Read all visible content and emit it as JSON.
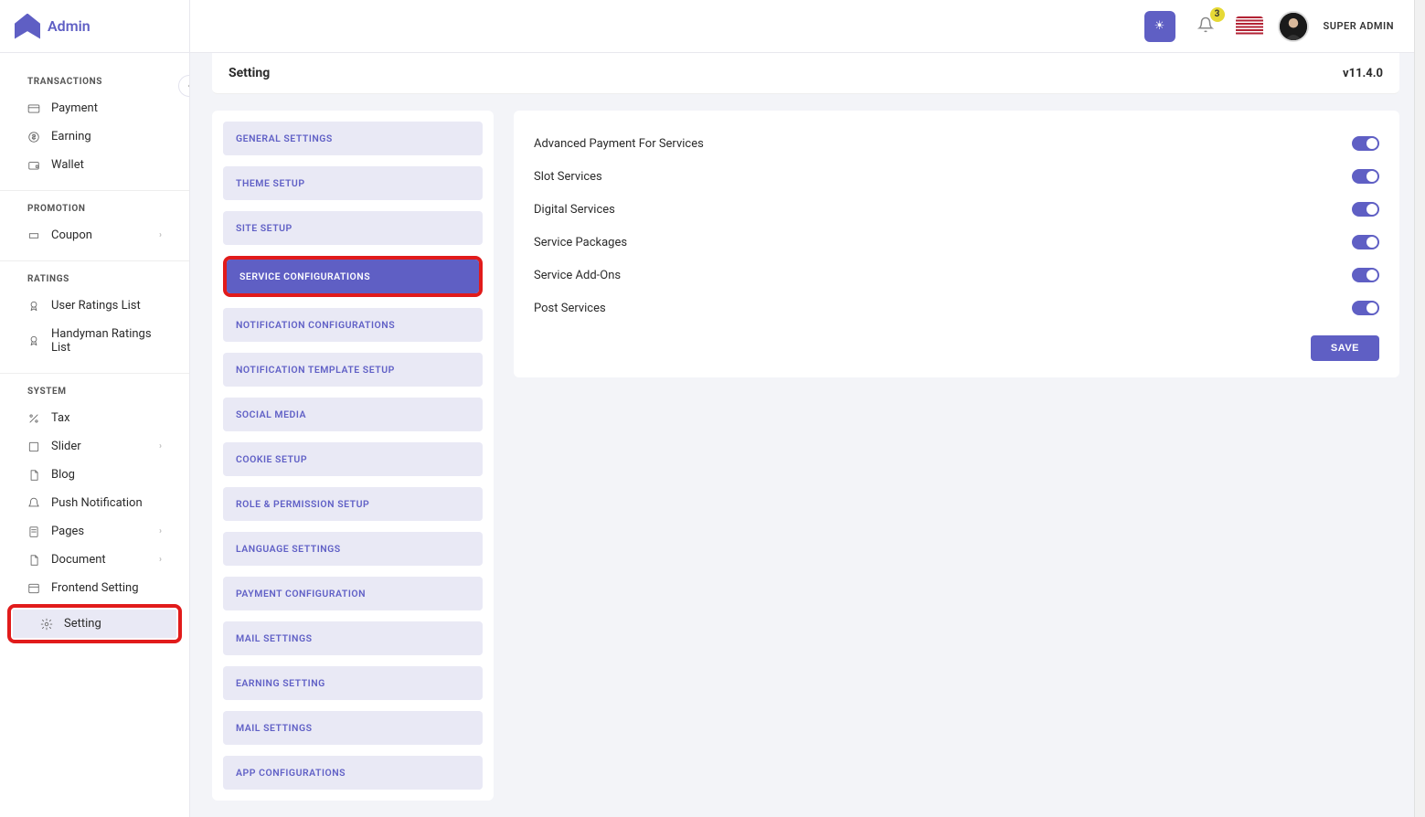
{
  "brand": "Admin",
  "topbar": {
    "badge": "3",
    "username": "SUPER ADMIN"
  },
  "page": {
    "title": "Setting",
    "version": "v11.4.0"
  },
  "sidebar": {
    "sections": [
      {
        "title": "TRANSACTIONS",
        "items": [
          {
            "label": "Payment",
            "icon": "card"
          },
          {
            "label": "Earning",
            "icon": "dollar"
          },
          {
            "label": "Wallet",
            "icon": "wallet"
          }
        ]
      },
      {
        "title": "PROMOTION",
        "items": [
          {
            "label": "Coupon",
            "icon": "ticket",
            "chevron": true
          }
        ]
      },
      {
        "title": "RATINGS",
        "items": [
          {
            "label": "User Ratings List",
            "icon": "badge"
          },
          {
            "label": "Handyman Ratings List",
            "icon": "badge"
          }
        ]
      },
      {
        "title": "SYSTEM",
        "items": [
          {
            "label": "Tax",
            "icon": "percent"
          },
          {
            "label": "Slider",
            "icon": "square",
            "chevron": true
          },
          {
            "label": "Blog",
            "icon": "doc"
          },
          {
            "label": "Push Notification",
            "icon": "bell"
          },
          {
            "label": "Pages",
            "icon": "page",
            "chevron": true
          },
          {
            "label": "Document",
            "icon": "doc",
            "chevron": true
          },
          {
            "label": "Frontend Setting",
            "icon": "layout"
          },
          {
            "label": "Setting",
            "icon": "gear",
            "active": true,
            "highlight": true
          }
        ]
      }
    ]
  },
  "tabs": [
    {
      "label": "GENERAL SETTINGS"
    },
    {
      "label": "THEME SETUP"
    },
    {
      "label": "SITE SETUP"
    },
    {
      "label": "SERVICE CONFIGURATIONS",
      "active": true,
      "highlight": true
    },
    {
      "label": "NOTIFICATION CONFIGURATIONS"
    },
    {
      "label": "NOTIFICATION TEMPLATE SETUP"
    },
    {
      "label": "SOCIAL MEDIA"
    },
    {
      "label": "COOKIE SETUP"
    },
    {
      "label": "ROLE & PERMISSION SETUP"
    },
    {
      "label": "LANGUAGE SETTINGS"
    },
    {
      "label": "PAYMENT CONFIGURATION"
    },
    {
      "label": "MAIL SETTINGS"
    },
    {
      "label": "EARNING SETTING"
    },
    {
      "label": "MAIL SETTINGS"
    },
    {
      "label": "APP CONFIGURATIONS"
    }
  ],
  "configs": [
    {
      "label": "Advanced Payment For Services",
      "on": true
    },
    {
      "label": "Slot Services",
      "on": true
    },
    {
      "label": "Digital Services",
      "on": true
    },
    {
      "label": "Service Packages",
      "on": true
    },
    {
      "label": "Service Add-Ons",
      "on": true
    },
    {
      "label": "Post Services",
      "on": true
    }
  ],
  "buttons": {
    "save": "SAVE"
  }
}
